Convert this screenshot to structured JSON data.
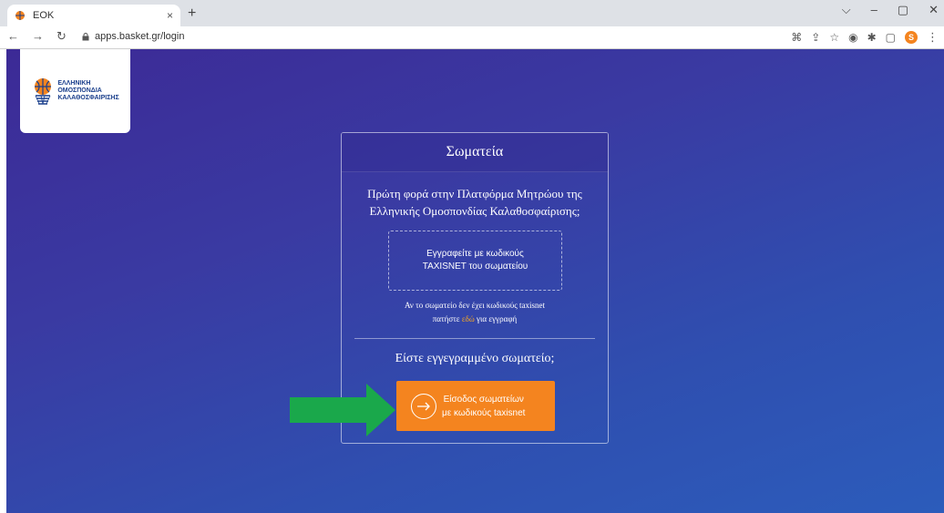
{
  "browser": {
    "tab_title": "EOK",
    "tab_close": "×",
    "new_tab": "+",
    "url": "apps.basket.gr/login",
    "profile_initial": "S",
    "win_controls": [
      "⌵",
      "–",
      "▢",
      "✕"
    ]
  },
  "logo": {
    "line1": "ΕΛΛΗΝΙΚΗ",
    "line2": "ΟΜΟΣΠΟΝΔΙΑ",
    "line3": "ΚΑΛΑΘΟΣΦΑΙΡΙΣΗΣ"
  },
  "card": {
    "title": "Σωματεία",
    "question": "Πρώτη φορά στην Πλατφόρμα Μητρώου της Ελληνικής Ομοσπονδίας Καλαθοσφαίρισης;",
    "register_line1": "Εγγραφείτε με κωδικούς",
    "register_line2": "TAXISNET του σωματείου",
    "note_line1": "Αν το σωματείο δεν έχει κωδικούς taxisnet",
    "note_pre": "πατήστε ",
    "note_link": "εδώ",
    "note_post": " για εγγραφή",
    "registered": "Είστε εγγεγραμμένο σωματείο;",
    "login_line1": "Είσοδος σωματείων",
    "login_line2": "με κωδικούς taxisnet"
  },
  "colors": {
    "accent": "#f4841f",
    "link": "#f6a623",
    "annotation_arrow": "#1aa84b"
  }
}
